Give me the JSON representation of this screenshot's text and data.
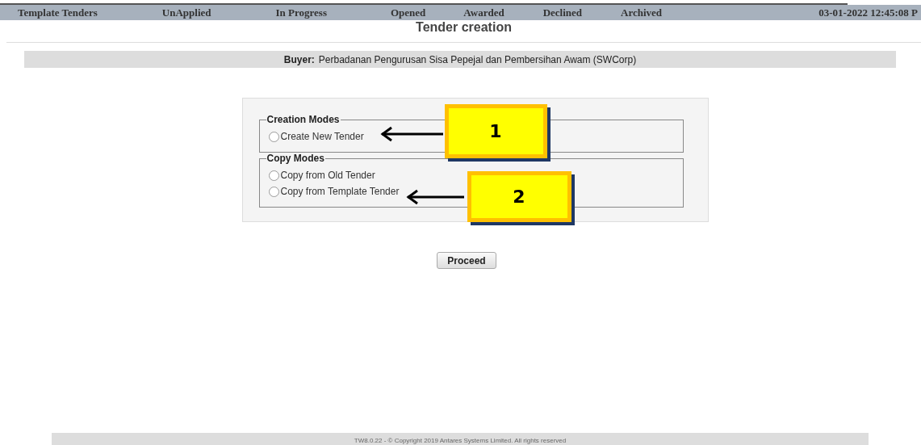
{
  "nav": {
    "tabs": [
      {
        "label": "Template Tenders",
        "selected": false
      },
      {
        "label": "UnApplied",
        "selected": false
      },
      {
        "label": "In Progress",
        "selected": false
      },
      {
        "label": "Opened",
        "selected": false
      },
      {
        "label": "Awarded",
        "selected": false
      },
      {
        "label": "Declined",
        "selected": false
      },
      {
        "label": "Archived",
        "selected": false
      }
    ],
    "datetime": "03-01-2022 12:45:08 P"
  },
  "title": "Tender creation",
  "buyer": {
    "label": "Buyer:",
    "value": "Perbadanan Pengurusan Sisa Pepejal dan Pembersihan Awam (SWCorp)"
  },
  "groups": [
    {
      "legend": "Creation Modes",
      "options": [
        {
          "label": "Create New Tender",
          "selected": false
        }
      ],
      "callout": "1"
    },
    {
      "legend": "Copy Modes",
      "options": [
        {
          "label": "Copy from Old Tender",
          "selected": false
        },
        {
          "label": "Copy from Template Tender",
          "selected": false
        }
      ],
      "callout": "2"
    }
  ],
  "proceed": "Proceed",
  "footer": "TW8.0.22 - © Copyright 2019 Antares Systems Limited. All rights reserved"
}
